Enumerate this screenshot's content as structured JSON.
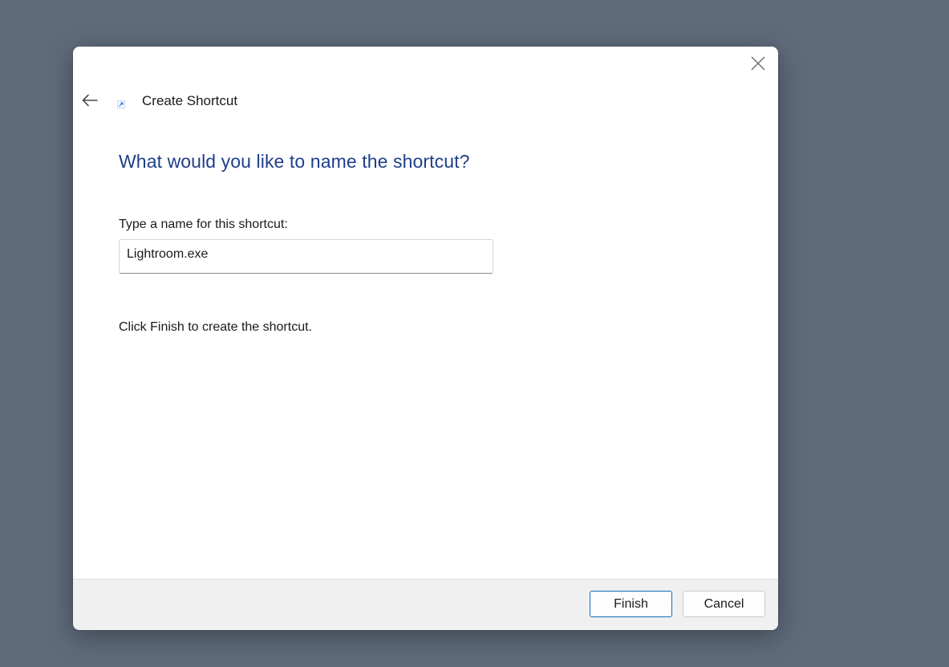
{
  "dialog": {
    "title": "Create Shortcut",
    "heading": "What would you like to name the shortcut?",
    "field_label": "Type a name for this shortcut:",
    "name_value": "Lightroom.exe",
    "hint": "Click Finish to create the shortcut."
  },
  "buttons": {
    "finish_label": "Finish",
    "cancel_label": "Cancel"
  },
  "icons": {
    "back": "back-arrow-icon",
    "close": "close-icon",
    "shortcut": "shortcut-icon"
  },
  "colors": {
    "desktop_background": "#5f6b7b",
    "heading": "#1f3f8a",
    "accent": "#0f6cbd"
  }
}
